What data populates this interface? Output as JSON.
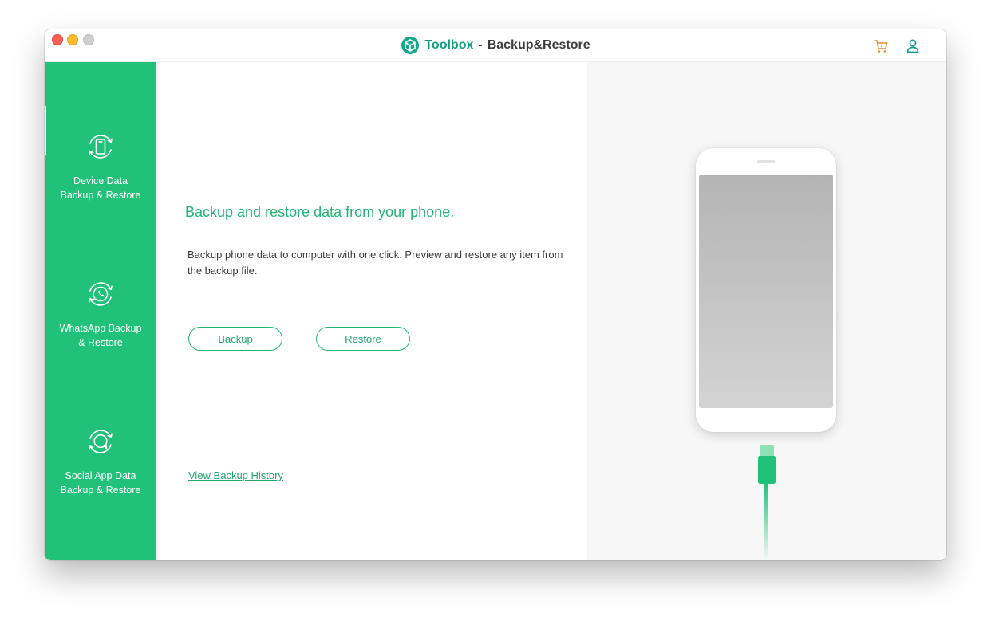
{
  "titlebar": {
    "brand": "Toolbox",
    "separator": "-",
    "page": "Backup&Restore",
    "logo_icon": "toolbox-cube-icon",
    "cart_icon": "cart-icon",
    "account_icon": "user-icon"
  },
  "sidebar": {
    "items": [
      {
        "line1": "Device Data",
        "line2": "Backup &  Restore",
        "icon": "device-sync-icon",
        "active": true
      },
      {
        "line1": "WhatsApp Backup",
        "line2": "&  Restore",
        "icon": "whatsapp-sync-icon",
        "active": false
      },
      {
        "line1": "Social App Data",
        "line2": "Backup &  Restore",
        "icon": "chat-sync-icon",
        "active": false
      }
    ]
  },
  "main": {
    "headline": "Backup and restore data from your phone.",
    "description": "Backup phone data to computer with one click. Preview and restore any item from the backup file.",
    "backup_label": "Backup",
    "restore_label": "Restore",
    "history_link": "View Backup History"
  },
  "colors": {
    "sidebar_green": "#21c17a",
    "accent_green": "#21b574",
    "brand_teal": "#0f9f7e",
    "cart_orange": "#f08a24",
    "panel_gray": "#f7f7f7"
  }
}
